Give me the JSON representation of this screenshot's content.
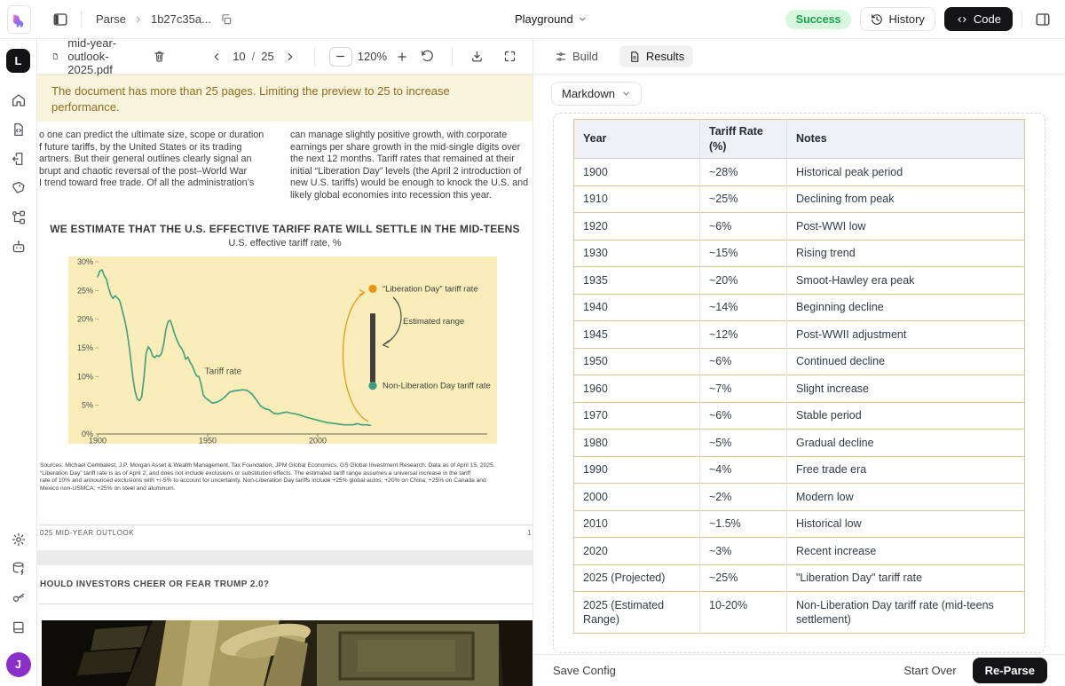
{
  "header": {
    "breadcrumb_app": "Parse",
    "breadcrumb_id": "1b27c35a...",
    "playground_label": "Playground",
    "status_badge": "Success",
    "history_label": "History",
    "code_label": "Code",
    "status_colors": {
      "bg": "#d7f7de",
      "text": "#17a34a"
    }
  },
  "sidebar": {
    "logo_letter": "L",
    "avatar_letter": "J",
    "avatar_color": "#8b2fc9",
    "top_icons": [
      "home-icon",
      "document-code-icon",
      "document-export-icon",
      "tags-icon",
      "hierarchy-icon",
      "bot-icon"
    ],
    "bottom_icons": [
      "settings-icon",
      "database-icon",
      "key-icon",
      "book-icon"
    ]
  },
  "pdf_panel": {
    "toolbar": {
      "filename": "mid-year-outlook-2025.pdf",
      "page_current": "10",
      "page_separator": "/",
      "page_total": "25",
      "zoom_level": "120%"
    },
    "warning": "The document has more than 25 pages. Limiting the preview to 25 to increase performance.",
    "page10": {
      "col_left_lines": [
        "o one can predict the ultimate size, scope or duration",
        "f future tariffs, by the United States or its trading",
        "artners. But their general outlines clearly signal an",
        "brupt and chaotic reversal of the post–World War",
        "I trend toward free trade. Of all the administration’s"
      ],
      "col_right_lines": [
        "can manage slightly positive growth, with corporate",
        "earnings per share growth in the mid-single digits over",
        "the next 12 months. Tariff rates that remained at their",
        "initial “Liberation Day” levels (the April 2 introduction of",
        "new U.S. tariffs) would be enough to knock the U.S. and",
        "likely global economies into recession this year."
      ],
      "sources_lines": [
        "Sources: Michael Cembalest, J.P. Morgan Asset & Wealth Management, Tax Foundation, JPM Global Economics, GS Global Investment Research. Data as of April 15, 2025.",
        "“Liberation Day” tariff rate is as of April 2, and does not include exclusions or substitution effects. The estimated tariff range assumes a universal increase in the tariff",
        "rate of 10% and announced exclusions with +/-5% to account for uncertainty. Non-Liberation Day tariffs include +25% global autos; +20% on China; +25% on Canada and",
        "Mexico non-USMCA;  +25% on steel and aluminum."
      ],
      "footer_left": "025 MID-YEAR OUTLOOK",
      "footer_right": "1"
    },
    "page11": {
      "heading": "HOULD INVESTORS CHEER OR FEAR TRUMP 2.0?"
    }
  },
  "results_panel": {
    "tabs": [
      {
        "label": "Build",
        "active": false
      },
      {
        "label": "Results",
        "active": true
      }
    ],
    "format_label": "Markdown",
    "table": {
      "headers": [
        "Year",
        "Tariff Rate (%)",
        "Notes"
      ],
      "rows": [
        [
          "1900",
          "~28%",
          "Historical peak period"
        ],
        [
          "1910",
          "~25%",
          "Declining from peak"
        ],
        [
          "1920",
          "~6%",
          "Post-WWI low"
        ],
        [
          "1930",
          "~15%",
          "Rising trend"
        ],
        [
          "1935",
          "~20%",
          "Smoot-Hawley era peak"
        ],
        [
          "1940",
          "~14%",
          "Beginning decline"
        ],
        [
          "1945",
          "~12%",
          "Post-WWII adjustment"
        ],
        [
          "1950",
          "~6%",
          "Continued decline"
        ],
        [
          "1960",
          "~7%",
          "Slight increase"
        ],
        [
          "1970",
          "~6%",
          "Stable period"
        ],
        [
          "1980",
          "~5%",
          "Gradual decline"
        ],
        [
          "1990",
          "~4%",
          "Free trade era"
        ],
        [
          "2000",
          "~2%",
          "Modern low"
        ],
        [
          "2010",
          "~1.5%",
          "Historical low"
        ],
        [
          "2020",
          "~3%",
          "Recent increase"
        ],
        [
          "2025 (Projected)",
          "~25%",
          "\"Liberation Day\" tariff rate"
        ],
        [
          "2025 (Estimated Range)",
          "10-20%",
          "Non-Liberation Day tariff rate (mid-teens settlement)"
        ]
      ]
    }
  },
  "footer_bar": {
    "save_config": "Save Config",
    "start_over": "Start Over",
    "reparse": "Re-Parse"
  },
  "chart_data": {
    "type": "line",
    "title": "WE ESTIMATE THAT THE U.S. EFFECTIVE TARIFF RATE WILL SETTLE IN THE MID-TEENS",
    "subtitle": "U.S. effective tariff rate, %",
    "background": "#f9eeba",
    "line_color": "#4aa17e",
    "xlim": [
      1900,
      2030
    ],
    "ylim": [
      0,
      30
    ],
    "y_tick_step": 5,
    "x_ticks": [
      1900,
      1950,
      2000
    ],
    "legend_position": "right-annotations",
    "grid": false,
    "series": [
      {
        "name": "Tariff rate",
        "x": [
          1900,
          1901,
          1902,
          1903,
          1904,
          1905,
          1906,
          1907,
          1908,
          1909,
          1910,
          1911,
          1912,
          1913,
          1914,
          1915,
          1916,
          1917,
          1918,
          1919,
          1920,
          1921,
          1922,
          1923,
          1924,
          1925,
          1926,
          1927,
          1928,
          1929,
          1930,
          1931,
          1932,
          1933,
          1934,
          1935,
          1936,
          1937,
          1938,
          1939,
          1940,
          1941,
          1942,
          1943,
          1944,
          1945,
          1946,
          1947,
          1948,
          1949,
          1950,
          1952,
          1954,
          1956,
          1958,
          1960,
          1962,
          1964,
          1966,
          1968,
          1970,
          1972,
          1974,
          1976,
          1978,
          1980,
          1982,
          1984,
          1986,
          1988,
          1990,
          1992,
          1994,
          1996,
          1998,
          2000,
          2002,
          2004,
          2006,
          2008,
          2010,
          2012,
          2014,
          2016,
          2018,
          2020,
          2022,
          2024
        ],
        "y": [
          27.4,
          28.4,
          28.6,
          27.6,
          27.0,
          25.4,
          24.2,
          23.6,
          24.1,
          23.7,
          23.3,
          21.8,
          20.3,
          18.6,
          16.2,
          13.2,
          9.8,
          7.4,
          6.1,
          5.8,
          6.4,
          9.6,
          14.0,
          15.2,
          14.7,
          13.6,
          13.3,
          13.7,
          13.5,
          14.0,
          15.6,
          18.2,
          19.6,
          19.8,
          18.7,
          17.4,
          16.4,
          15.5,
          15.0,
          14.3,
          13.0,
          13.4,
          12.5,
          11.9,
          10.9,
          10.1,
          10.0,
          8.7,
          6.8,
          6.3,
          6.0,
          5.4,
          5.5,
          5.9,
          6.5,
          7.3,
          7.5,
          7.6,
          7.7,
          7.6,
          7.0,
          6.0,
          4.9,
          4.4,
          4.2,
          3.6,
          3.5,
          3.7,
          3.8,
          3.6,
          3.5,
          3.3,
          3.0,
          2.8,
          2.6,
          2.4,
          2.2,
          2.0,
          1.9,
          1.8,
          1.7,
          1.6,
          1.6,
          1.6,
          1.8,
          1.6,
          1.6,
          1.5
        ]
      }
    ],
    "annotations": [
      {
        "type": "point",
        "x": 2025,
        "y": 25.3,
        "color": "#ee9413",
        "label": "“Liberation Day” tariff rate"
      },
      {
        "type": "range_bar",
        "x": 2025,
        "y_low": 9,
        "y_high": 21,
        "color": "#3f3f3f",
        "label": "Estimated range"
      },
      {
        "type": "point",
        "x": 2025,
        "y": 8.4,
        "color": "#3a9e85",
        "label": "Non-Liberation Day tariff rate"
      },
      {
        "type": "series_label",
        "x": 1957,
        "y": 10.4,
        "label": "Tariff rate"
      }
    ]
  }
}
